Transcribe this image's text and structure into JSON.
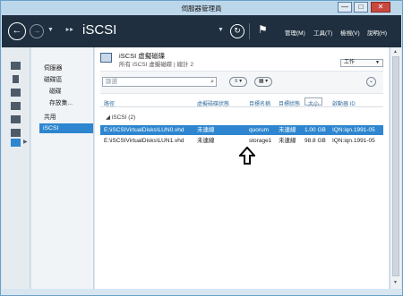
{
  "window": {
    "title": "伺服器管理員",
    "min_label": "—",
    "max_label": "□",
    "close_label": "✕"
  },
  "nav": {
    "back_icon": "back-arrow-icon",
    "forward_icon": "forward-arrow-icon",
    "crumb_arrows": "‣‣",
    "page_title": "iSCSI",
    "refresh_icon": "refresh-icon",
    "flag_icon": "flag-icon",
    "menu": [
      "管理(M)",
      "工具(T)",
      "檢視(V)",
      "說明(H)"
    ]
  },
  "tree": {
    "items": [
      "伺服器",
      "磁碟區",
      "磁碟",
      "存放集...",
      "共用",
      "iSCSI"
    ],
    "selected": "iSCSI"
  },
  "header": {
    "title": "iSCSI 虛擬磁碟",
    "subtitle": "所有 iSCSI 虛擬磁碟 | 總計 2",
    "tasks_label": "工作"
  },
  "filter": {
    "placeholder": "篩選",
    "search_icon": "⌕"
  },
  "columns": [
    "路徑",
    "虛擬磁碟狀態",
    "目標名稱",
    "目標狀態",
    "大小",
    "啟動器 ID"
  ],
  "group_label": "iSCSI (2)",
  "rows": [
    {
      "path": "E:\\iSCSIVirtualDisks\\LUN0.vhd",
      "disk_status": "未連線",
      "target": "quorum",
      "target_status": "未連線",
      "size": "1.00 GB",
      "initiator": "IQN:iqn.1991-05"
    },
    {
      "path": "E:\\iSCSIVirtualDisks\\LUN1.vhd",
      "disk_status": "未連線",
      "target": "storage1",
      "target_status": "未連線",
      "size": "98.8 GB",
      "initiator": "IQN:iqn.1991-05"
    }
  ],
  "colors": {
    "navbar": "#1f2f3f",
    "accent": "#2d86cf",
    "titlebar": "#bcd6ea"
  }
}
